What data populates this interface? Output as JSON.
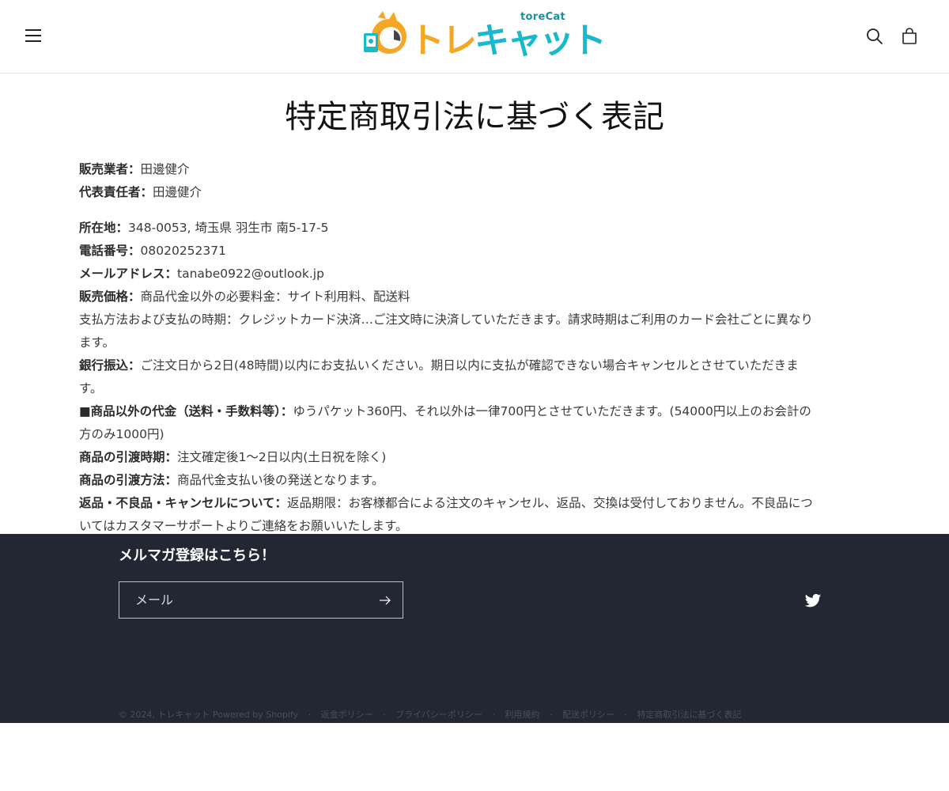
{
  "header": {
    "logo": {
      "latin": "toreCat",
      "jp_part1": "トレ",
      "jp_part2": "キャット"
    },
    "icons": {
      "menu": "hamburger-menu-icon",
      "search": "search-icon",
      "cart": "cart-bag-icon"
    }
  },
  "page": {
    "title": "特定商取引法に基づく表記"
  },
  "content": {
    "seller_label": "販売業者：",
    "seller_value": "田邊健介",
    "rep_label": "代表責任者：",
    "rep_value": "田邊健介",
    "address_label": "所在地：",
    "address_value": "348-0053, 埼玉県 羽生市 南5-17-5",
    "phone_label": "電話番号：",
    "phone_value": "08020252371",
    "email_label": "メールアドレス：",
    "email_value": "tanabe0922@outlook.jp",
    "price_label": "販売価格：",
    "price_value": "商品代金以外の必要料金：サイト利用料、配送料",
    "payment_line1": "支払方法および支払の時期：クレジットカード決済…ご注文時に決済していただきます。請求時期はご利用のカード会社ごとに異なり",
    "payment_line2": "ます。",
    "bank_label": "銀行振込：",
    "bank_line1": "ご注文日から2日(48時間)以内にお支払いください。期日以内に支払が確認できない場合キャンセルとさせていただきま",
    "bank_line2": "す。",
    "fees_label": "■商品以外の代金（送料・手数料等）：",
    "fees_line1": "ゆうパケット360円、それ以外は一律700円とさせていただきます。(54000円以上のお会計の",
    "fees_line2": "方のみ1000円)",
    "delivery_time_label": "商品の引渡時期：",
    "delivery_time_value": "注文確定後1〜2日以内(土日祝を除く)",
    "delivery_method_label": "商品の引渡方法：",
    "delivery_method_value": "商品代金支払い後の発送となります。",
    "returns_label": "返品・不良品・キャンセルについて：",
    "returns_line1": "返品期限：お客様都合による注文のキャンセル、返品、交換は受付しておりません。不良品につ",
    "returns_line2": "いてはカスタマーサポートよりご連絡をお願いいたします。"
  },
  "footer": {
    "newsletter_title": "メルマガ登録はこちら！",
    "email_placeholder": "メール",
    "icons": {
      "submit": "arrow-right-icon",
      "social": "twitter-icon"
    },
    "copyright": "© 2024, トレキャット Powered by Shopify",
    "separator": "·",
    "policies": [
      "返金ポリシー",
      "プライバシーポリシー",
      "利用規約",
      "配送ポリシー",
      "特定商取引法に基づく表記"
    ]
  },
  "colors": {
    "footer_bg": "#232733",
    "logo_orange": "#f5a623",
    "logo_cyan": "#19b9cc",
    "text": "#3a3a3a"
  }
}
